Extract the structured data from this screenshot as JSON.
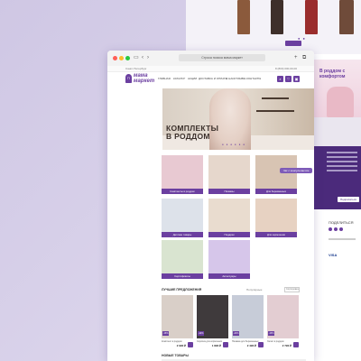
{
  "colors": {
    "brand": "#6b3fa0",
    "brand_dark": "#4b2a7b",
    "background": "#d9d2ea"
  },
  "browser": {
    "url": "Строка поиска мама маркет",
    "icons": [
      "sidebar-icon",
      "back-icon",
      "forward-icon",
      "add-tab-icon",
      "tabs-icon"
    ]
  },
  "topbar": {
    "city": "Санкт-Петербург",
    "phone": "8 (800) 000-00-00"
  },
  "header": {
    "logo_line1": "мама",
    "logo_line2": "маркет",
    "nav": [
      "ГЛАВНАЯ",
      "КАТАЛОГ",
      "АКЦИИ",
      "ДОСТАВКА И ОПЛАТА",
      "О НАС",
      "ОТЗЫВЫ",
      "КОНТАКТЫ"
    ]
  },
  "hero": {
    "title_line1": "КОМПЛЕКТЫ",
    "title_line2": "В РОДДОМ"
  },
  "categories": [
    {
      "label": "Комплекты в роддом",
      "color": "#e8c9d2"
    },
    {
      "label": "Пижамы",
      "color": "#e6d7cc"
    },
    {
      "label": "Для беременных",
      "color": "#d8c4b3"
    },
    {
      "label": "Детские товары",
      "color": "#dde2ea"
    },
    {
      "label": "Подарки",
      "color": "#e9dccf"
    },
    {
      "label": "Для кормления",
      "color": "#e7d2c2"
    },
    {
      "label": "Сертификаты",
      "color": "#d9e4d0"
    },
    {
      "label": "Аксессуары",
      "color": "#d6c6ea"
    }
  ],
  "chat_button": "Чат с консультантом",
  "products_section": {
    "title": "ЛУЧШИЕ ПРЕДЛОЖЕНИЯ",
    "tools": "Популярные",
    "sort": "Сортировка"
  },
  "products": [
    {
      "badge": "-15%",
      "name": "Комплект в роддом",
      "price": "2 990 ₽",
      "color": "#d9cfc8"
    },
    {
      "badge": "-10%",
      "name": "Сорочка для кормления",
      "price": "1 890 ₽",
      "color": "#3f3a3c"
    },
    {
      "badge": "-20%",
      "name": "Пижама для беременных",
      "price": "2 490 ₽",
      "color": "#c7ccd8"
    },
    {
      "badge": "-15%",
      "name": "Халат в роддом",
      "price": "2 790 ₽",
      "color": "#e3cdd2"
    }
  ],
  "more_section": "НОВЫЕ ТОВАРЫ",
  "background_page": {
    "banner_text": "В роддом с комфортом",
    "subscribe_button": "Подписаться",
    "footer_title": "ПОДЕЛИТЬСЯ",
    "payment": "VISA",
    "photos": [
      "#8b5a3c",
      "#3e2f2a",
      "#9a2d2d",
      "#6f4b3a"
    ]
  }
}
